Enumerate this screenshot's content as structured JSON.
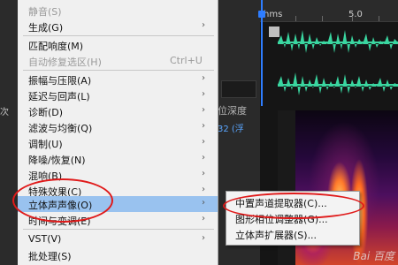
{
  "menu": {
    "items": [
      {
        "label": "静音(S)",
        "shortcut": "",
        "submenu": false,
        "disabled": true
      },
      {
        "label": "生成(G)",
        "shortcut": "",
        "submenu": true,
        "disabled": false
      },
      {
        "label": "匹配响度(M)",
        "shortcut": "",
        "submenu": false,
        "disabled": false
      },
      {
        "label": "自动修复选区(H)",
        "shortcut": "Ctrl+U",
        "submenu": false,
        "disabled": true
      },
      {
        "label": "振幅与压限(A)",
        "shortcut": "",
        "submenu": true,
        "disabled": false
      },
      {
        "label": "延迟与回声(L)",
        "shortcut": "",
        "submenu": true,
        "disabled": false
      },
      {
        "label": "诊断(D)",
        "shortcut": "",
        "submenu": true,
        "disabled": false
      },
      {
        "label": "滤波与均衡(Q)",
        "shortcut": "",
        "submenu": true,
        "disabled": false
      },
      {
        "label": "调制(U)",
        "shortcut": "",
        "submenu": true,
        "disabled": false
      },
      {
        "label": "降噪/恢复(N)",
        "shortcut": "",
        "submenu": true,
        "disabled": false
      },
      {
        "label": "混响(B)",
        "shortcut": "",
        "submenu": true,
        "disabled": false
      },
      {
        "label": "特殊效果(C)",
        "shortcut": "",
        "submenu": true,
        "disabled": false
      },
      {
        "label": "立体声声像(O)",
        "shortcut": "",
        "submenu": true,
        "disabled": false
      },
      {
        "label": "时间与变调(E)",
        "shortcut": "",
        "submenu": true,
        "disabled": false
      },
      {
        "label": "VST(V)",
        "shortcut": "",
        "submenu": true,
        "disabled": false
      },
      {
        "label": "批处理(S)",
        "shortcut": "",
        "submenu": false,
        "disabled": false
      }
    ]
  },
  "submenu": {
    "items": [
      {
        "label": "中置声道提取器(C)..."
      },
      {
        "label": "图形相位调整器(G)..."
      },
      {
        "label": "立体声扩展器(S)..."
      }
    ]
  },
  "background": {
    "left_fragment": "次",
    "field_label": "位深度",
    "field_value": "32 (浮"
  },
  "ruler": {
    "unit": "hms",
    "tick": "5.0"
  },
  "watermark": "Bai 百度",
  "colors": {
    "highlight": "#99c2ef",
    "waveform": "#3ad6a0",
    "annotation": "#e01a1a",
    "playhead": "#2e7dff"
  }
}
